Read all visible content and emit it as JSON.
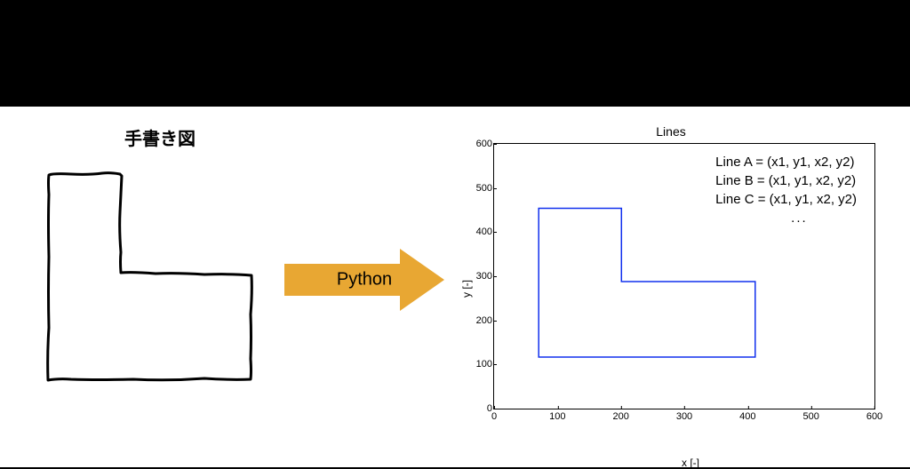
{
  "left": {
    "title": "手書き図"
  },
  "arrow": {
    "label": "Python"
  },
  "chart_data": {
    "type": "line",
    "title": "Lines",
    "xlabel": "x [-]",
    "ylabel": "y [-]",
    "xlim": [
      0,
      600
    ],
    "ylim": [
      0,
      600
    ],
    "xticks": [
      0,
      100,
      200,
      300,
      400,
      500,
      600
    ],
    "yticks": [
      0,
      100,
      200,
      300,
      400,
      500,
      600
    ],
    "shape_points": [
      [
        70,
        455
      ],
      [
        200,
        455
      ],
      [
        200,
        290
      ],
      [
        410,
        290
      ],
      [
        410,
        120
      ],
      [
        70,
        120
      ],
      [
        70,
        455
      ]
    ],
    "annotations": {
      "lineA": "Line A = (x1, y1, x2, y2)",
      "lineB": "Line B = (x1, y1, x2, y2)",
      "lineC": "Line C = (x1, y1, x2, y2)",
      "more": "..."
    }
  }
}
